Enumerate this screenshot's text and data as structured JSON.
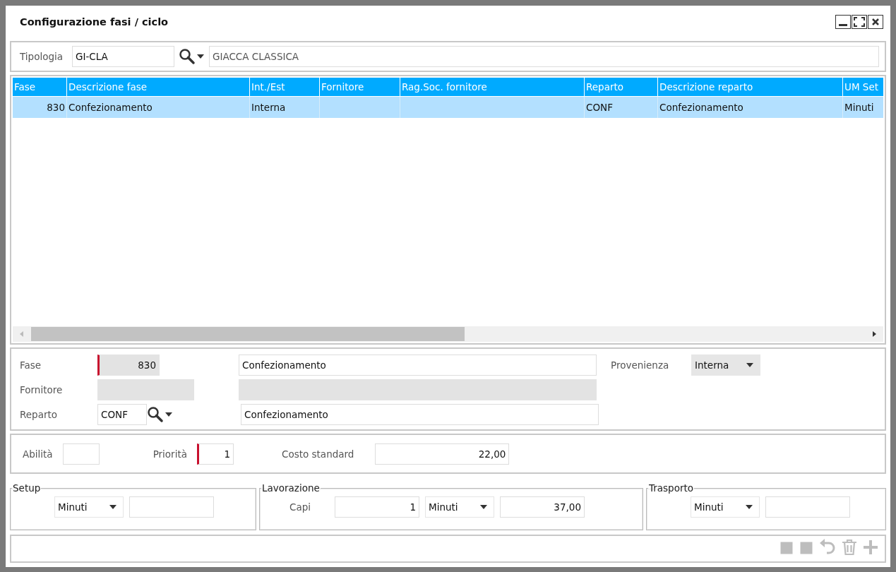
{
  "window": {
    "title": "Configurazione fasi / ciclo"
  },
  "tipologia": {
    "label": "Tipologia",
    "code": "GI-CLA",
    "description": "GIACCA CLASSICA"
  },
  "table": {
    "columns": [
      "Fase",
      "Descrizione fase",
      "Int./Est",
      "Fornitore",
      "Rag.Soc. fornitore",
      "Reparto",
      "Descrizione reparto",
      "UM Set"
    ],
    "rows": [
      {
        "selected": true,
        "cells": [
          "830",
          "Confezionamento",
          "Interna",
          "",
          "",
          "CONF",
          "Confezionamento",
          "Minuti"
        ]
      }
    ]
  },
  "detail": {
    "fase": {
      "label": "Fase",
      "value": "830",
      "description": "Confezionamento",
      "required": true,
      "disabled": true
    },
    "fornitore": {
      "label": "Fornitore",
      "disabled": true
    },
    "reparto": {
      "label": "Reparto",
      "value": "CONF",
      "description": "Confezionamento"
    },
    "provenienza": {
      "label": "Provenienza",
      "value": "Interna",
      "disabled": true
    }
  },
  "params": {
    "abilita": {
      "label": "Abilità"
    },
    "priorita": {
      "label": "Priorità",
      "value": "1",
      "required": true
    },
    "costo": {
      "label": "Costo standard",
      "value": "22,00"
    }
  },
  "groups": {
    "setup": {
      "title": "Setup",
      "unit": "Minuti"
    },
    "lavorazione": {
      "title": "Lavorazione",
      "capi_label": "Capi",
      "capi_value": "1",
      "unit": "Minuti",
      "value": "37,00"
    },
    "trasporto": {
      "title": "Trasporto",
      "unit": "Minuti"
    }
  },
  "toolbar": [
    {
      "kind": "square",
      "disabled": true
    },
    {
      "kind": "square",
      "disabled": true
    },
    {
      "kind": "undo",
      "disabled": true
    },
    {
      "kind": "trash",
      "disabled": true
    },
    {
      "kind": "add",
      "disabled": true
    }
  ]
}
